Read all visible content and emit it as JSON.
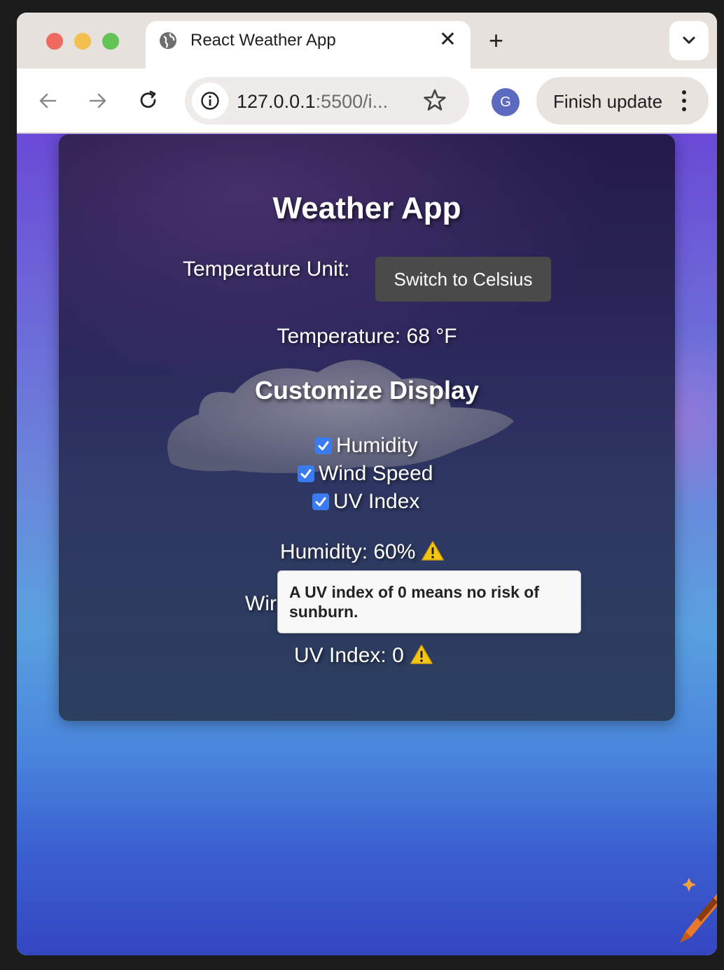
{
  "browser": {
    "tab_title": "React Weather App",
    "tab_close": "✕",
    "new_tab": "+",
    "url_host": "127.0.0.1",
    "url_rest": ":5500/i...",
    "profile_initial": "G",
    "update_button": "Finish update"
  },
  "app": {
    "title": "Weather App",
    "unit_label": "Temperature Unit:",
    "switch_button": "Switch to Celsius",
    "temperature": "Temperature: 68 °F",
    "customize_title": "Customize Display",
    "options": {
      "humidity": "Humidity",
      "wind": "Wind Speed",
      "uv": "UV Index"
    },
    "stats": {
      "humidity": "Humidity: 60%",
      "wind_partial": "Wir",
      "uv": "UV Index: 0"
    },
    "tooltip": "A UV index of 0 means no risk of sunburn."
  },
  "icons": [
    "globe-icon",
    "chevron-down-icon",
    "back-arrow-icon",
    "forward-arrow-icon",
    "reload-icon",
    "info-icon",
    "star-icon",
    "kebab-icon",
    "checkbox-check-icon",
    "warning-icon",
    "crayon-icon"
  ],
  "colors": {
    "checkbox": "#3a7bf0",
    "button": "#4a4a4a",
    "warning": "#f5c518"
  }
}
